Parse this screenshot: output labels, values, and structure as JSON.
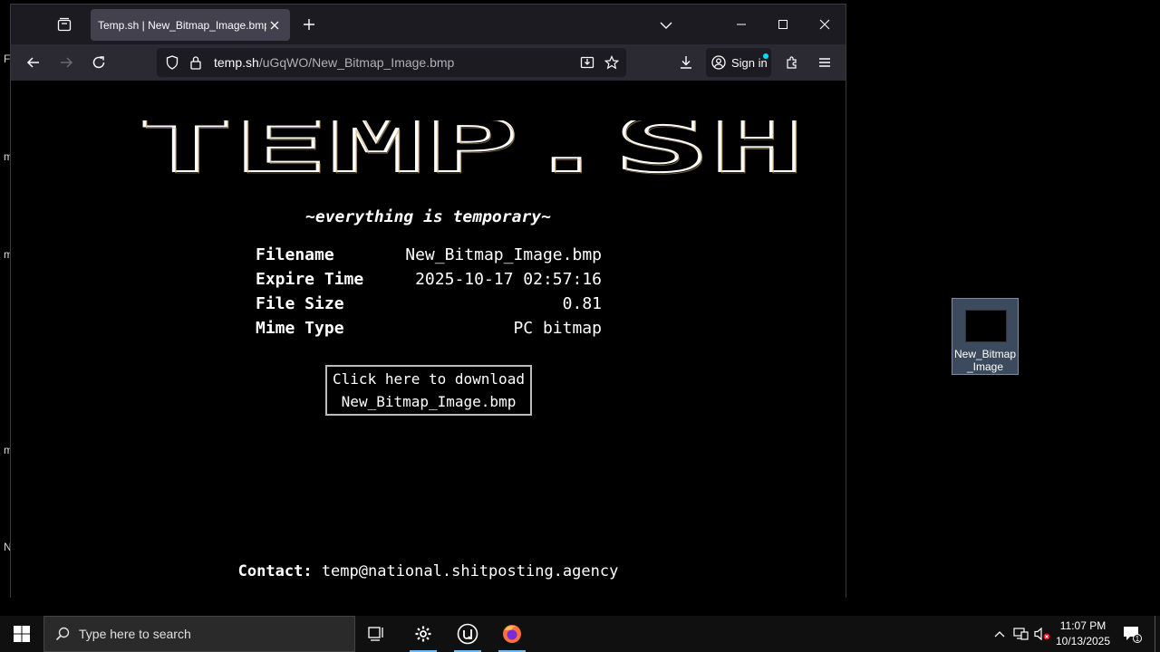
{
  "desktop": {
    "edge_glyphs": [
      "F",
      "m",
      "m",
      "m",
      "N"
    ],
    "icon": {
      "label_line1": "New_Bitmap",
      "label_line2": "_Image",
      "icon": "bitmap-file-icon"
    }
  },
  "browser": {
    "tab": {
      "title": "Temp.sh | New_Bitmap_Image.bmp"
    },
    "url": {
      "host": "temp.sh",
      "path": "/uGqWO/New_Bitmap_Image.bmp"
    },
    "signin_label": "Sign in"
  },
  "page": {
    "logo_text": "TEMP.SH",
    "tagline": "~everything is temporary~",
    "info": [
      {
        "label": "Filename",
        "value": "New_Bitmap_Image.bmp"
      },
      {
        "label": "Expire Time",
        "value": "2025-10-17 02:57:16"
      },
      {
        "label": "File Size",
        "value": "0.81"
      },
      {
        "label": "Mime Type",
        "value": "PC bitmap"
      }
    ],
    "download": {
      "line1": "Click here to download",
      "line2": "New_Bitmap_Image.bmp"
    },
    "contact_label": "Contact:",
    "contact_email": "temp@national.shitposting.agency"
  },
  "taskbar": {
    "search_placeholder": "Type here to search",
    "time": "11:07 PM",
    "date": "10/13/2025",
    "notification_count": "1"
  },
  "colors": {
    "accent": "#76b9ed",
    "tab_active": "#42414d",
    "toolbar": "#2b2a33",
    "tabbar": "#1c1b22"
  }
}
